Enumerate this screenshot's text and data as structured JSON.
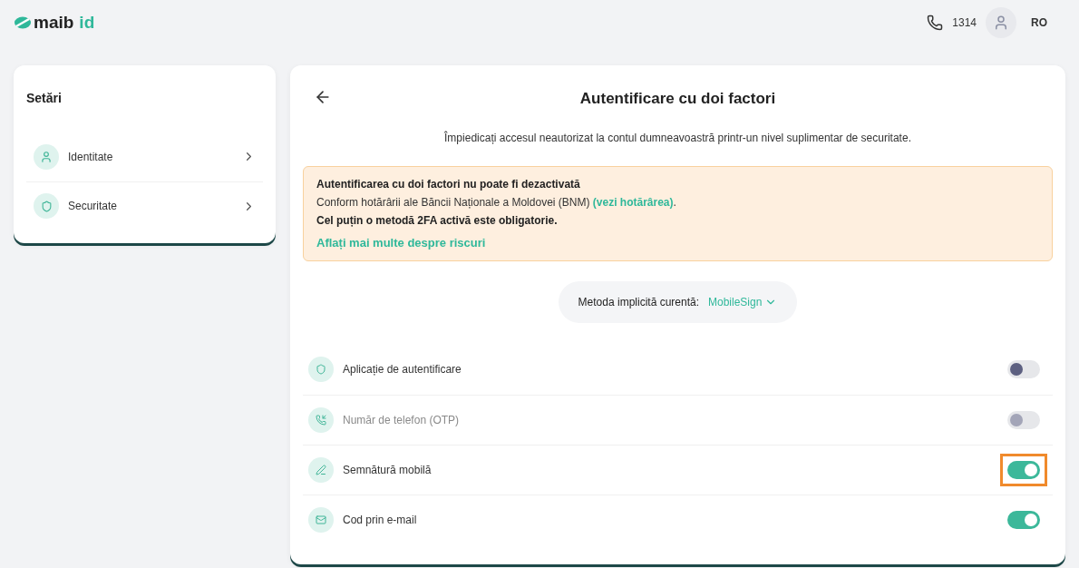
{
  "header": {
    "logo": "maib",
    "logo_suffix": "id",
    "phone": "1314",
    "language": "RO"
  },
  "sidebar": {
    "title": "Setări",
    "items": [
      {
        "kind": "user",
        "label": "Identitate"
      },
      {
        "kind": "shield",
        "label": "Securitate"
      }
    ]
  },
  "main": {
    "title": "Autentificare cu doi factori",
    "subtitle": "Împiedicați accesul neautorizat la contul dumneavoastră printr-un nivel suplimentar de securitate.",
    "warning": {
      "title": "Autentificarea cu doi factori nu poate fi dezactivată",
      "text": "Conform hotărârii ale Băncii Naționale a Moldovei (BNM)",
      "link": "(vezi hotărârea)",
      "after_link": ".",
      "note": "Cel puțin o metodă 2FA activă este obligatorie.",
      "more_link": "Aflați mai multe despre riscuri"
    },
    "default_method": {
      "label": "Metoda implicită curentă:",
      "value": "MobileSign"
    },
    "methods": [
      {
        "kind": "shield",
        "label": "Aplicație de autentificare",
        "on": false,
        "disabled": false,
        "highlighted": false
      },
      {
        "kind": "phone",
        "label": "Număr de telefon (OTP)",
        "on": false,
        "disabled": true,
        "highlighted": false
      },
      {
        "kind": "pen",
        "label": "Semnătură mobilă",
        "on": true,
        "disabled": false,
        "highlighted": true
      },
      {
        "kind": "mail",
        "label": "Cod prin e-mail",
        "on": true,
        "disabled": false,
        "highlighted": false
      }
    ]
  }
}
